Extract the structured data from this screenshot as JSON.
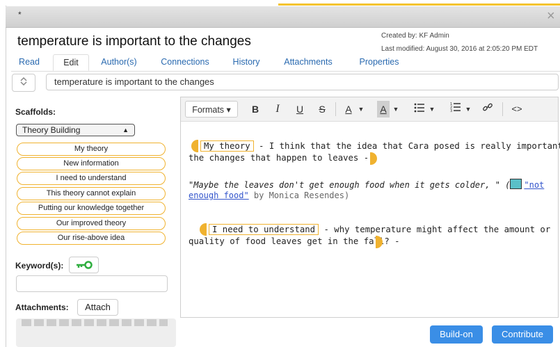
{
  "window": {
    "marker": "*",
    "close_label": "×"
  },
  "note": {
    "title": "temperature is important to the changes",
    "created_by": "Created by: KF Admin",
    "last_modified": "Last modified: August 30, 2016 at 2:05:20 PM EDT"
  },
  "tabs": [
    {
      "label": "Read",
      "active": false
    },
    {
      "label": "Edit",
      "active": true
    },
    {
      "label": "Author(s)",
      "active": false
    },
    {
      "label": "Connections",
      "active": false
    },
    {
      "label": "History",
      "active": false
    },
    {
      "label": "Attachments",
      "active": false
    },
    {
      "label": "Properties",
      "active": false
    }
  ],
  "title_field": {
    "value": "temperature is important to the changes",
    "icon": "sort-arrows-icon"
  },
  "scaffolds": {
    "label": "Scaffolds:",
    "selected": "Theory Building",
    "items": [
      "My theory",
      "New information",
      "I need to understand",
      "This theory cannot explain",
      "Putting our knowledge together",
      "Our improved theory",
      "Our rise-above idea"
    ]
  },
  "keywords": {
    "label": "Keyword(s):",
    "icon": "key-icon",
    "value": ""
  },
  "attachments": {
    "label": "Attachments:",
    "button": "Attach"
  },
  "toolbar": {
    "formats": "Formats",
    "bold": "B",
    "italic": "I",
    "underline": "U",
    "strike": "S",
    "font_color": "A",
    "bg_color": "A",
    "bullets": "☰",
    "numbered": "☰",
    "link": "🔗",
    "code": "<>"
  },
  "content": {
    "p1_tag": "My theory",
    "p1_line1": " - I think that the idea that Cara posed is really important to",
    "p1_line2": "the changes that happen to leaves  -",
    "quote_text": "\"Maybe the leaves don't get enough food when it gets colder, \" (",
    "quote_link_1": "\"not",
    "quote_link_2": "enough food\"",
    "quote_by": " by Monica Resendes)",
    "p2_tag": "I need to understand",
    "p2_line1": " - why temperature might affect the amount or",
    "p2_line2": "quality of food leaves get in the fall? -"
  },
  "actions": {
    "build_on": "Build-on",
    "contribute": "Contribute"
  },
  "colors": {
    "accent": "#3a8ee6",
    "scaffold_border": "#f0b22f",
    "link": "#2a6ab0"
  }
}
